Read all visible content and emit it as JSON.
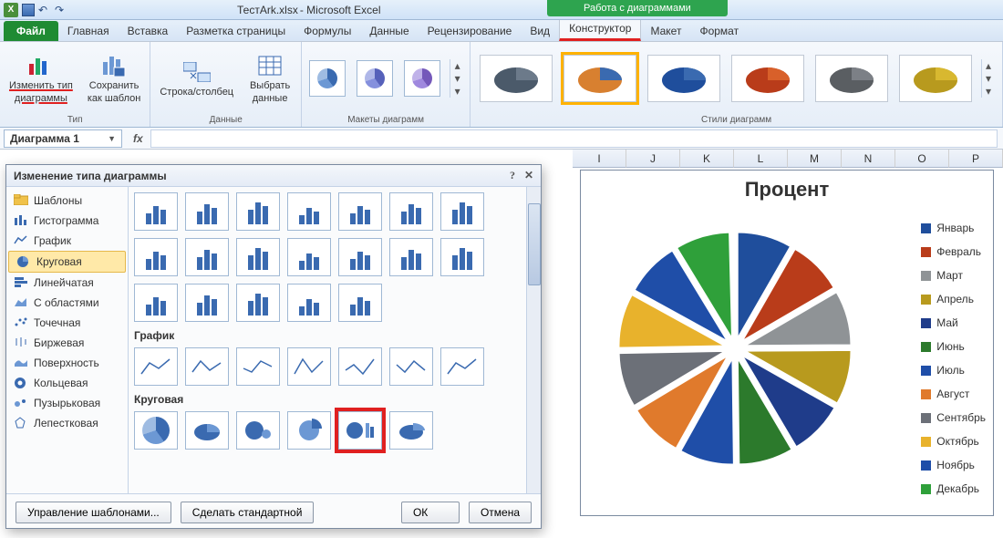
{
  "app": {
    "doc": "ТестArk.xlsx",
    "suffix": " - Microsoft Excel",
    "chart_tools_label": "Работа с диаграммами"
  },
  "tabs": {
    "file": "Файл",
    "items": [
      "Главная",
      "Вставка",
      "Разметка страницы",
      "Формулы",
      "Данные",
      "Рецензирование",
      "Вид"
    ],
    "chart_items": [
      "Конструктор",
      "Макет",
      "Формат"
    ]
  },
  "ribbon": {
    "change_type": {
      "l1": "Изменить тип",
      "l2": "диаграммы"
    },
    "save_tpl": {
      "l1": "Сохранить",
      "l2": "как шаблон"
    },
    "grp_type": "Тип",
    "switch_rc": "Строка/столбец",
    "select_data": {
      "l1": "Выбрать",
      "l2": "данные"
    },
    "grp_data": "Данные",
    "grp_layouts": "Макеты диаграмм",
    "grp_styles": "Стили диаграмм",
    "scroll_up": "▴",
    "scroll_down": "▾",
    "scroll_more": "▾"
  },
  "fx": {
    "name": "Диаграмма 1",
    "fx": "fx"
  },
  "columns": [
    "I",
    "J",
    "K",
    "L",
    "M",
    "N",
    "O",
    "P"
  ],
  "chart": {
    "title": "Процент",
    "legend": [
      {
        "label": "Январь",
        "color": "#1f4e9c"
      },
      {
        "label": "Февраль",
        "color": "#b93c1a"
      },
      {
        "label": "Март",
        "color": "#8f9396"
      },
      {
        "label": "Апрель",
        "color": "#b89a1e"
      },
      {
        "label": "Май",
        "color": "#1f3c8a"
      },
      {
        "label": "Июнь",
        "color": "#2c7a2c"
      },
      {
        "label": "Июль",
        "color": "#1f4ea8"
      },
      {
        "label": "Август",
        "color": "#e07a2c"
      },
      {
        "label": "Сентябрь",
        "color": "#6c7078"
      },
      {
        "label": "Октябрь",
        "color": "#e8b22c"
      },
      {
        "label": "Ноябрь",
        "color": "#1f4ea8"
      },
      {
        "label": "Декабрь",
        "color": "#2fa03a"
      }
    ]
  },
  "dialog": {
    "title": "Изменение типа диаграммы",
    "help": "?",
    "close": "✕",
    "side": [
      {
        "label": "Шаблоны",
        "icon": "folder"
      },
      {
        "label": "Гистограмма",
        "icon": "bars"
      },
      {
        "label": "График",
        "icon": "line"
      },
      {
        "label": "Круговая",
        "icon": "pie",
        "selected": true
      },
      {
        "label": "Линейчатая",
        "icon": "hbar"
      },
      {
        "label": "С областями",
        "icon": "area"
      },
      {
        "label": "Точечная",
        "icon": "scatter"
      },
      {
        "label": "Биржевая",
        "icon": "stock"
      },
      {
        "label": "Поверхность",
        "icon": "surface"
      },
      {
        "label": "Кольцевая",
        "icon": "donut"
      },
      {
        "label": "Пузырьковая",
        "icon": "bubble"
      },
      {
        "label": "Лепестковая",
        "icon": "radar"
      }
    ],
    "section_line": "График",
    "section_pie": "Круговая",
    "manage_tpl": "Управление шаблонами...",
    "set_default": "Сделать стандартной",
    "ok": "ОК",
    "cancel": "Отмена"
  },
  "chart_data": {
    "type": "pie",
    "title": "Процент",
    "categories": [
      "Январь",
      "Февраль",
      "Март",
      "Апрель",
      "Май",
      "Июнь",
      "Июль",
      "Август",
      "Сентябрь",
      "Октябрь",
      "Ноябрь",
      "Декабрь"
    ],
    "values": [
      8.3,
      8.3,
      8.3,
      8.3,
      8.3,
      8.3,
      8.3,
      8.3,
      8.3,
      8.3,
      8.3,
      8.3
    ],
    "colors": [
      "#1f4e9c",
      "#b93c1a",
      "#8f9396",
      "#b89a1e",
      "#1f3c8a",
      "#2c7a2c",
      "#1f4ea8",
      "#e07a2c",
      "#6c7078",
      "#e8b22c",
      "#1f4ea8",
      "#2fa03a"
    ]
  }
}
